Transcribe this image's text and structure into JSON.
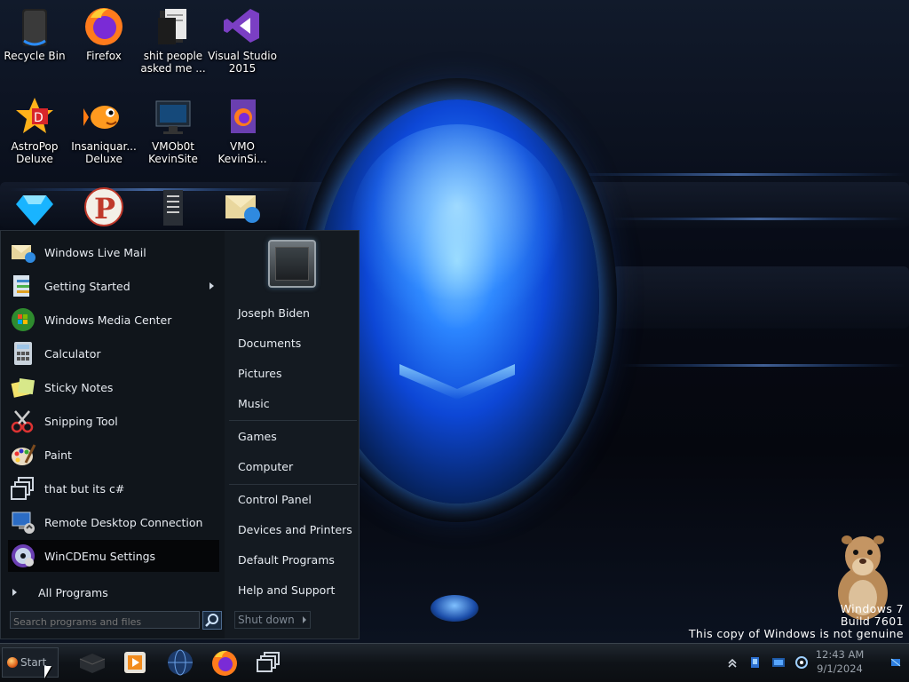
{
  "desktop": {
    "icons": [
      {
        "label": "Recycle Bin"
      },
      {
        "label": "Firefox"
      },
      {
        "label": "shit people asked me ..."
      },
      {
        "label": "Visual Studio 2015"
      },
      {
        "label": "AstroPop Deluxe"
      },
      {
        "label": "Insaniquar... Deluxe"
      },
      {
        "label": "VMOb0t KevinSite"
      },
      {
        "label": "VMO KevinSi..."
      },
      {
        "label": ""
      },
      {
        "label": ""
      },
      {
        "label": ""
      },
      {
        "label": ""
      }
    ],
    "watermark": {
      "line1": "Windows 7",
      "line2": "Build 7601",
      "line3": "This copy of Windows is not genuine"
    }
  },
  "start_menu": {
    "programs": [
      {
        "label": "Windows Live Mail"
      },
      {
        "label": "Getting Started"
      },
      {
        "label": "Windows Media Center"
      },
      {
        "label": "Calculator"
      },
      {
        "label": "Sticky Notes"
      },
      {
        "label": "Snipping Tool"
      },
      {
        "label": "Paint"
      },
      {
        "label": "that but its c#"
      },
      {
        "label": "Remote Desktop Connection"
      },
      {
        "label": "WinCDEmu Settings"
      }
    ],
    "all_programs": "All Programs",
    "search": {
      "value": "",
      "placeholder": "Search programs and files"
    },
    "right_pane": [
      {
        "label": "Joseph Biden"
      },
      {
        "label": "Documents"
      },
      {
        "label": "Pictures"
      },
      {
        "label": "Music"
      },
      {
        "label": "Games"
      },
      {
        "label": "Computer"
      },
      {
        "label": "Control Panel"
      },
      {
        "label": "Devices and Printers"
      },
      {
        "label": "Default Programs"
      },
      {
        "label": "Help and Support"
      }
    ],
    "shutdown": "Shut down"
  },
  "taskbar": {
    "start_label": "Start",
    "clock": {
      "time": "12:43 AM",
      "date": "9/1/2024"
    }
  },
  "colors": {
    "accent_blue": "#2c86ff",
    "menu_bg": "#141a21",
    "taskbar_bg": "#0f1318"
  }
}
